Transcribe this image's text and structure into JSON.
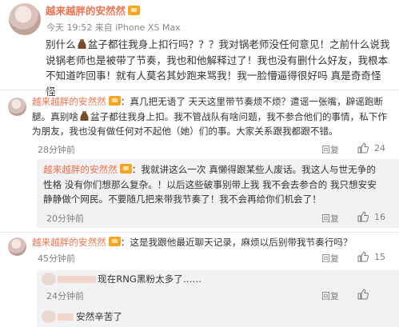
{
  "post": {
    "username": "越来越胖的安然然",
    "time_source": "今天 19:52 来自 iPhone XS Max",
    "text_before_icon": "别什么",
    "text_after_icon": "盆子都往我身上扣行吗？？？我对锅老师没任何意见！之前什么说我说锅老师也是被带了节奏，我也和他解释过了！我也没有删什么好友，我根本不知道咋回事！就有人莫名其妙跑来骂我！我一脸懵逼得很好吗 真是奇奇怪怪"
  },
  "comments": [
    {
      "username": "越来越胖的安然然",
      "text_before_icon": "：真几把无语了 天天这里带节奏烦不烦？遣谣一张嘴，辟谣跑断腿。真别啥",
      "text_after_icon": "盆子都往我身上扣。我不管战队有啥问题，我不参合他们的事情，私下作为朋友，我也没有做任何对不起他（她）们的事。大家关系跟我都跟不错。",
      "time": "28分钟前",
      "reply_label": "回复",
      "like_count": "24"
    },
    {
      "username": "越来越胖的安然然",
      "text": "：我就讲这么一次 真懒得跟某些人废话。我这人与世无争的性格 没有你们想那么复杂。！以后这些破事别带上我 我不会去参合的 我只想安安静静做个网民。不要随几把来带我节奏了！我不会再给你们机会了！",
      "time": "20分钟前",
      "reply_label": "回复",
      "like_count": "16"
    },
    {
      "username": "越来越胖的安然然",
      "text": "：这是我跟他最近聊天记录，麻烦以后别带我节奏行吗？",
      "time": "45分钟前",
      "reply_label": "回复",
      "like_count": "15"
    },
    {
      "text": "现在RNG黑粉太多了……",
      "time": "24分钟前",
      "reply_label": "回复"
    },
    {
      "text": "安然辛苦了"
    }
  ]
}
